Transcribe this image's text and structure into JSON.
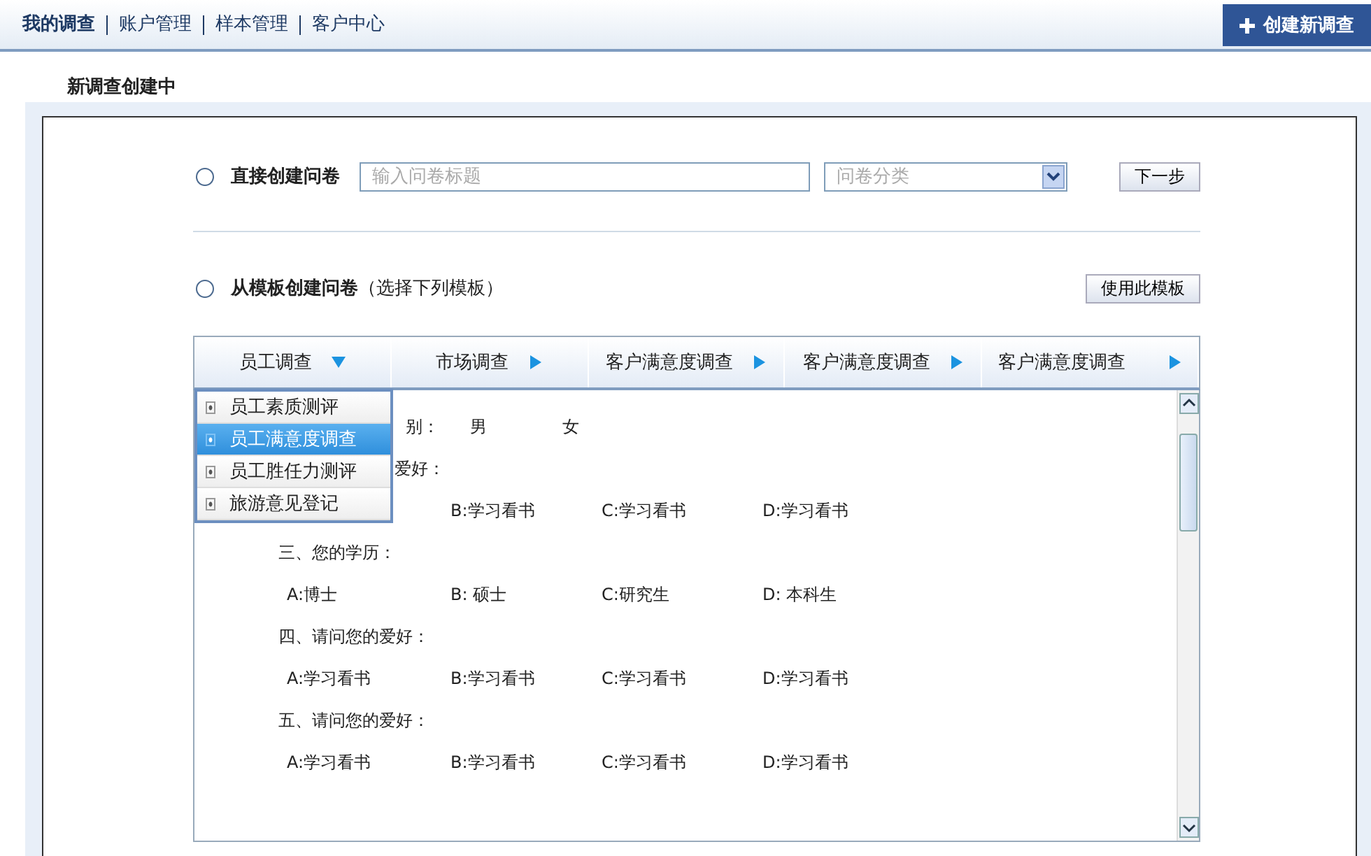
{
  "nav": {
    "items": [
      {
        "label": "我的调查",
        "selected": true
      },
      {
        "label": "账户管理",
        "selected": false
      },
      {
        "label": "样本管理",
        "selected": false
      },
      {
        "label": "客户中心",
        "selected": false
      }
    ],
    "create_button": "创建新调查"
  },
  "page_title": "新调查创建中",
  "direct": {
    "selected": false,
    "label": "直接创建问卷",
    "title_placeholder": "输入问卷标题",
    "category_placeholder": "问卷分类",
    "next_button": "下一步"
  },
  "template": {
    "selected": false,
    "label": "从模板创建问卷",
    "hint": "（选择下列模板）",
    "use_button": "使用此模板"
  },
  "tabs": [
    {
      "label": "员工调查",
      "expanded": true
    },
    {
      "label": "市场调查",
      "expanded": false
    },
    {
      "label": "客户满意度调查",
      "expanded": false
    },
    {
      "label": "客户满意度调查",
      "expanded": false
    },
    {
      "label": "客户满意度调查",
      "expanded": false
    }
  ],
  "menu": [
    {
      "label": "员工素质测评",
      "selected": false
    },
    {
      "label": "员工满意度调查",
      "selected": true
    },
    {
      "label": "员工胜任力测评",
      "selected": false
    },
    {
      "label": "旅游意见登记",
      "selected": false
    }
  ],
  "lines": [
    {
      "kind": "cut",
      "text": "别：",
      "options": [
        "男",
        "女"
      ]
    },
    {
      "kind": "cut",
      "text": "爱好："
    },
    {
      "kind": "options",
      "options": [
        "B:学习看书",
        "C:学习看书",
        "D:学习看书"
      ]
    },
    {
      "kind": "question",
      "text": "三、您的学历："
    },
    {
      "kind": "options",
      "options": [
        "A:博士",
        "B: 硕士",
        "C:研究生",
        "D: 本科生"
      ]
    },
    {
      "kind": "question",
      "text": "四、请问您的爱好："
    },
    {
      "kind": "options",
      "options": [
        "A:学习看书",
        "B:学习看书",
        "C:学习看书",
        "D:学习看书"
      ]
    },
    {
      "kind": "question",
      "text": "五、请问您的爱好："
    },
    {
      "kind": "options",
      "options": [
        "A:学习看书",
        "B:学习看书",
        "C:学习看书",
        "D:学习看书"
      ]
    }
  ]
}
